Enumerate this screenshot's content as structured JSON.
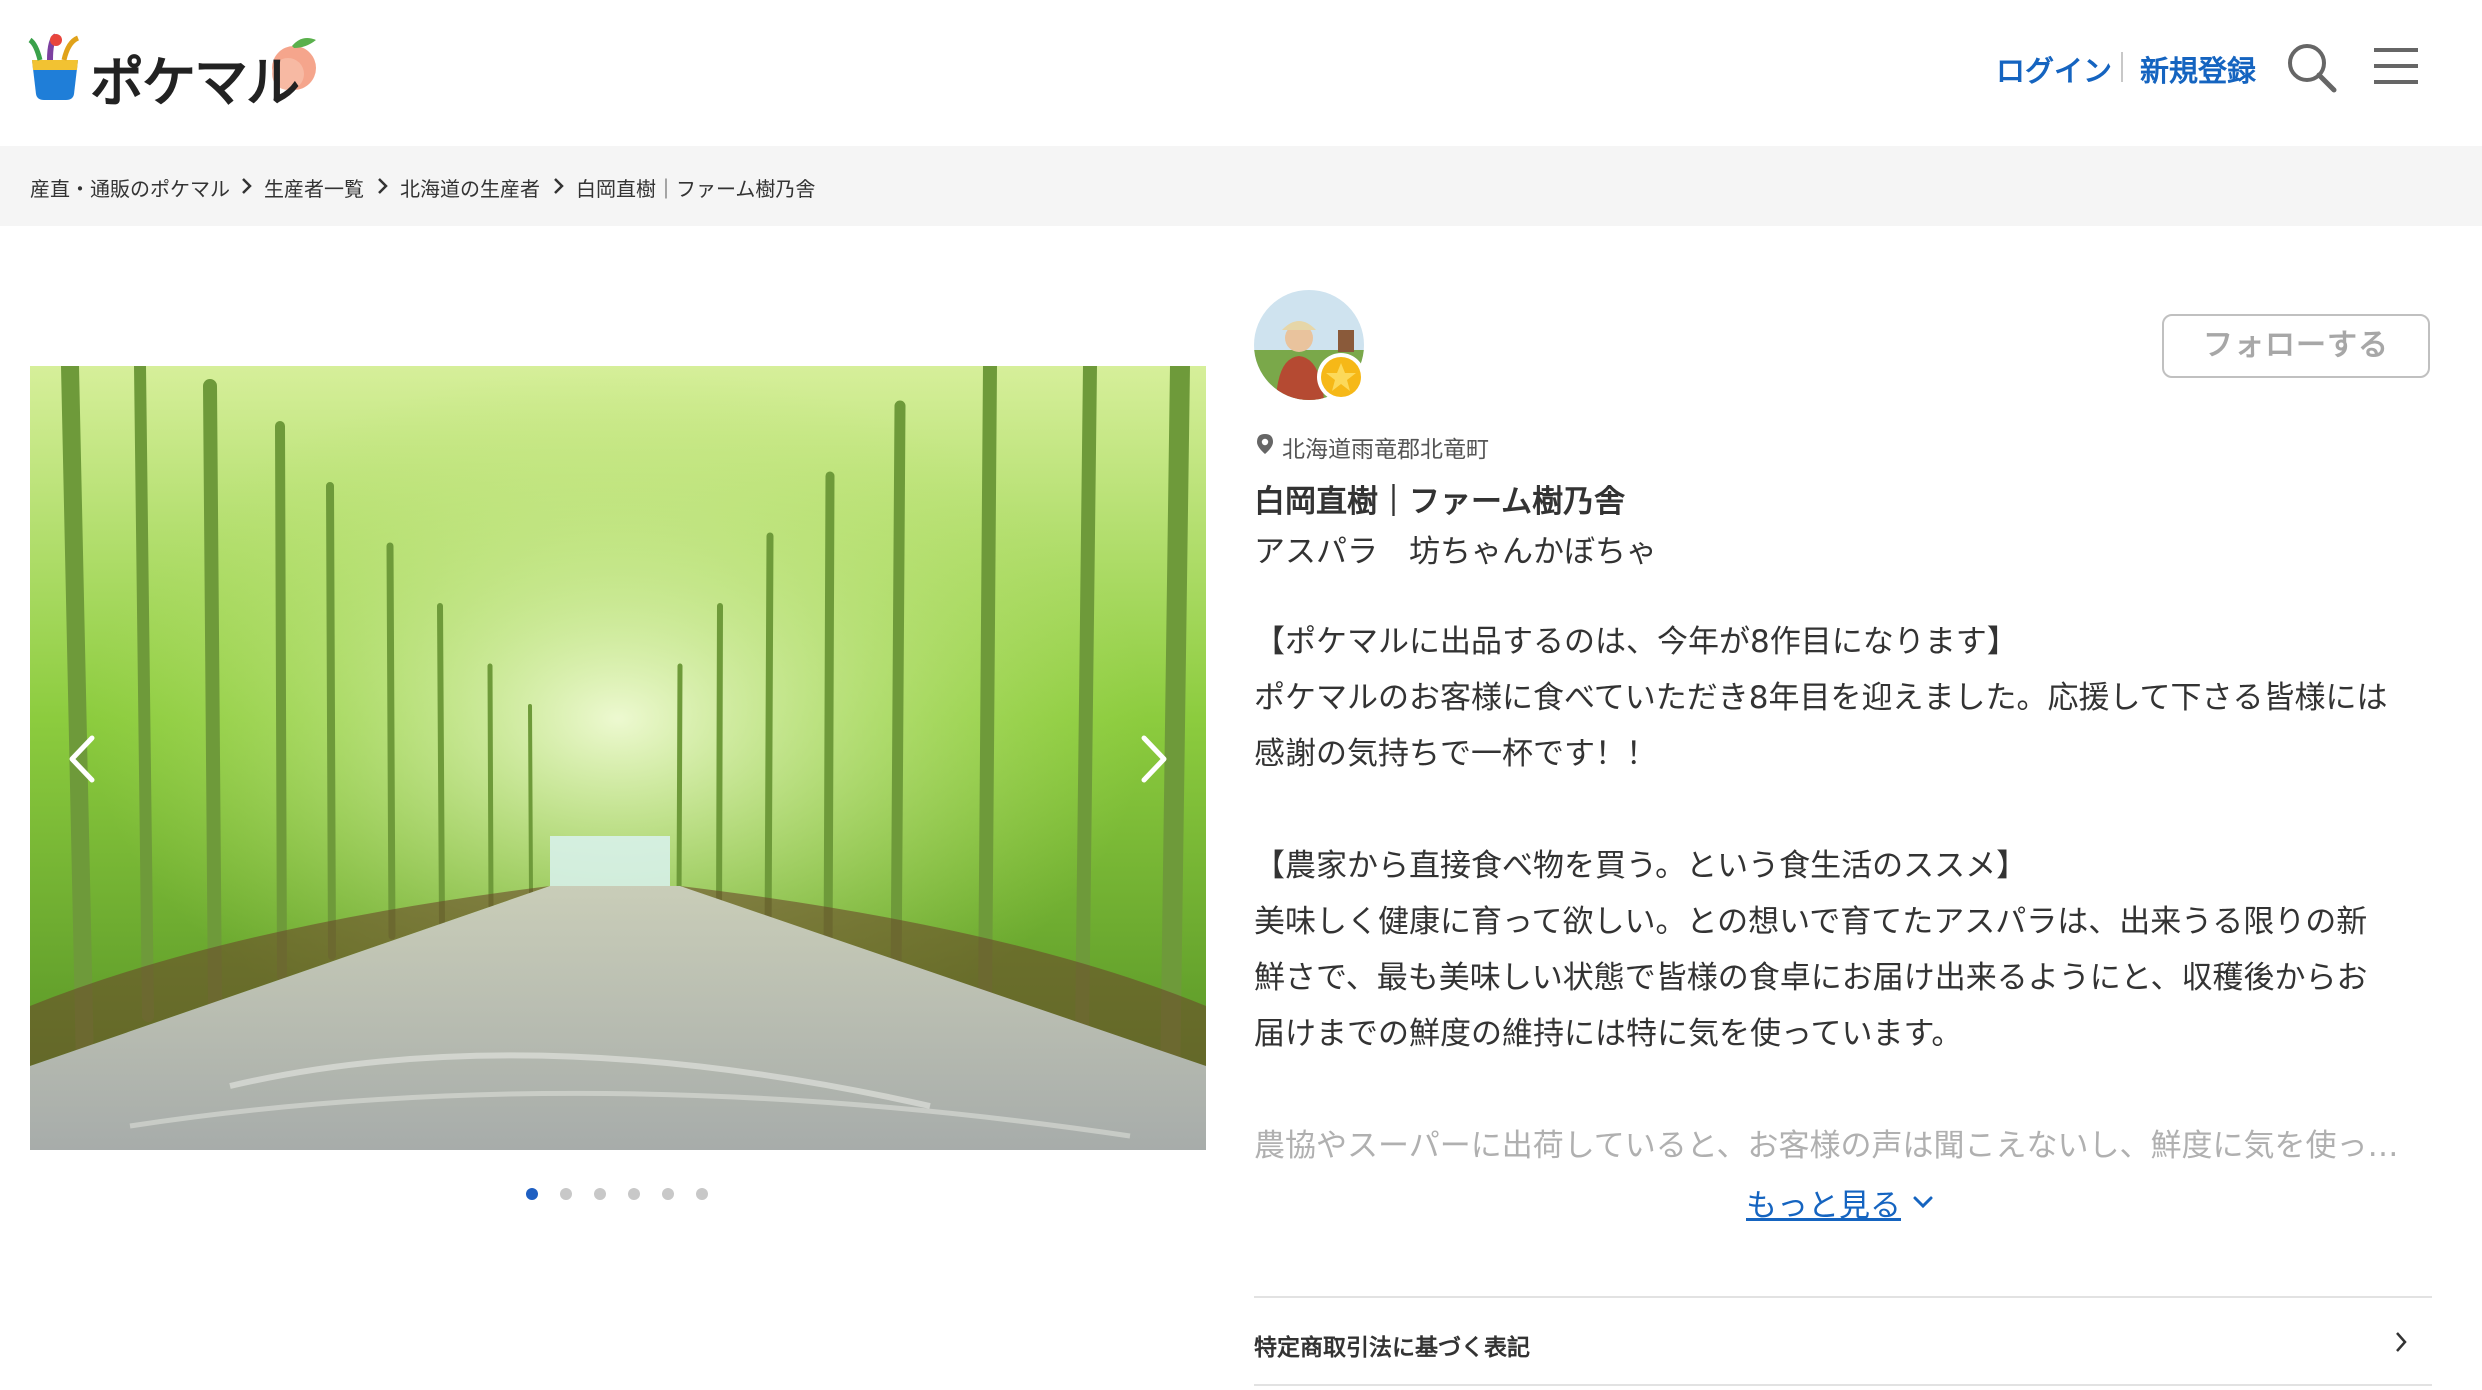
{
  "header": {
    "logo_text": "ポケマル",
    "login_label": "ログイン",
    "signup_label": "新規登録",
    "search_icon": "search-icon",
    "menu_icon": "hamburger-menu-icon",
    "accent_color": "#1564c0"
  },
  "breadcrumb": {
    "items": [
      "産直・通販のポケマル",
      "生産者一覧",
      "北海道の生産者",
      "白岡直樹｜ファーム樹乃舎"
    ]
  },
  "carousel": {
    "prev_icon": "chevron-left-icon",
    "next_icon": "chevron-right-icon",
    "slide_count": 6,
    "active_index": 0
  },
  "producer": {
    "follow_label": "フォローする",
    "location": "北海道雨竜郡北竜町",
    "name": "白岡直樹｜ファーム樹乃舎",
    "items": "アスパラ　坊ちゃんかぼちゃ",
    "badge_icon": "star-badge-icon"
  },
  "description": {
    "lines": [
      "【ポケマルに出品するのは、今年が8作目になります】",
      "ポケマルのお客様に食べていただき8年目を迎えました。応援して下さる皆様には",
      "感謝の気持ちで一杯です！！",
      "",
      "【農家から直接食べ物を買う。という食生活のススメ】",
      "美味しく健康に育って欲しい。との想いで育てたアスパラは、出来うる限りの新",
      "鮮さで、最も美味しい状態で皆様の食卓にお届け出来るようにと、収穫後からお",
      "届けまでの鮮度の維持には特に気を使っています。",
      "",
      "農協やスーパーに出荷していると、お客様の声は聞こえないし、鮮度に気を使っ…"
    ],
    "more_label": "もっと見る"
  },
  "law_link": {
    "label": "特定商取引法に基づく表記"
  }
}
